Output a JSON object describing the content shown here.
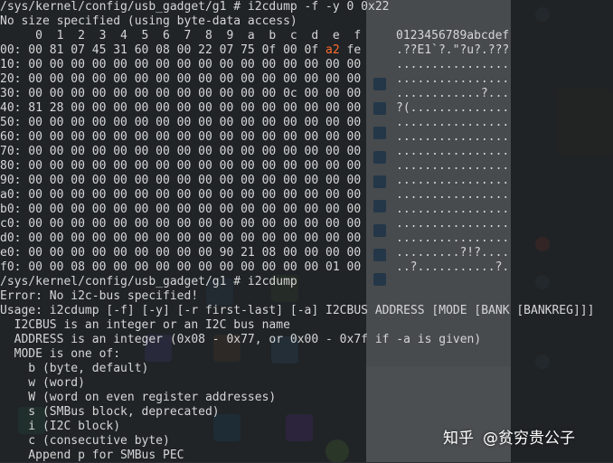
{
  "terminal": {
    "lines": [
      "/sys/kernel/config/usb_gadget/g1 # i2cdump -f -y 0 0x22",
      "No size specified (using byte-data access)",
      "     0  1  2  3  4  5  6  7  8  9  a  b  c  d  e  f",
      "00: 00 81 07 45 31 60 08 00 22 07 75 0f 00 0f a2 fe",
      "10: 00 00 00 00 00 00 00 00 00 00 00 00 00 00 00 00",
      "20: 00 00 00 00 00 00 00 00 00 00 00 00 00 00 00 00",
      "30: 00 00 00 00 00 00 00 00 00 00 00 00 0c 00 00 00",
      "40: 81 28 00 00 00 00 00 00 00 00 00 00 00 00 00 00",
      "50: 00 00 00 00 00 00 00 00 00 00 00 00 00 00 00 00",
      "60: 00 00 00 00 00 00 00 00 00 00 00 00 00 00 00 00",
      "70: 00 00 00 00 00 00 00 00 00 00 00 00 00 00 00 00",
      "80: 00 00 00 00 00 00 00 00 00 00 00 00 00 00 00 00",
      "90: 00 00 00 00 00 00 00 00 00 00 00 00 00 00 00 00",
      "a0: 00 00 00 00 00 00 00 00 00 00 00 00 00 00 00 00",
      "b0: 00 00 00 00 00 00 00 00 00 00 00 00 00 00 00 00",
      "c0: 00 00 00 00 00 00 00 00 00 00 00 00 00 00 00 00",
      "d0: 00 00 00 00 00 00 00 00 00 00 00 00 00 00 00 00",
      "e0: 00 00 00 00 00 00 00 00 00 90 21 08 00 00 00 00",
      "f0: 00 00 08 00 00 00 00 00 00 00 00 00 00 00 01 00",
      "/sys/kernel/config/usb_gadget/g1 # i2cdump",
      "Error: No i2c-bus specified!",
      "Usage: i2cdump [-f] [-y] [-r first-last] [-a] I2CBUS ADDRESS [MODE [BANK [BANKREG]]]",
      "  I2CBUS is an integer or an I2C bus name",
      "  ADDRESS is an integer (0x08 - 0x77, or 0x00 - 0x7f if -a is given)",
      "  MODE is one of:",
      "    b (byte, default)",
      "    w (word)",
      "    W (word on even register addresses)",
      "    s (SMBus block, deprecated)",
      "    i (I2C block)",
      "    c (consecutive byte)",
      "    Append p for SMBus PEC"
    ],
    "ascii_header": "0123456789abcdef",
    "ascii_rows": [
      ".??E1`?.\"?u?.???",
      "................",
      "................",
      "............?...",
      "?(..............",
      "................",
      "................",
      "................",
      "................",
      "................",
      "................",
      "................",
      "................",
      "................",
      ".........?!?....",
      "..?...........?."
    ]
  },
  "watermark": {
    "brand": "知乎",
    "author": "@贫穷贵公子"
  },
  "colors": {
    "terminal_text": "#d6d6d6",
    "highlight": "#ff6b2a",
    "terminal_bg": "#1e2124"
  }
}
